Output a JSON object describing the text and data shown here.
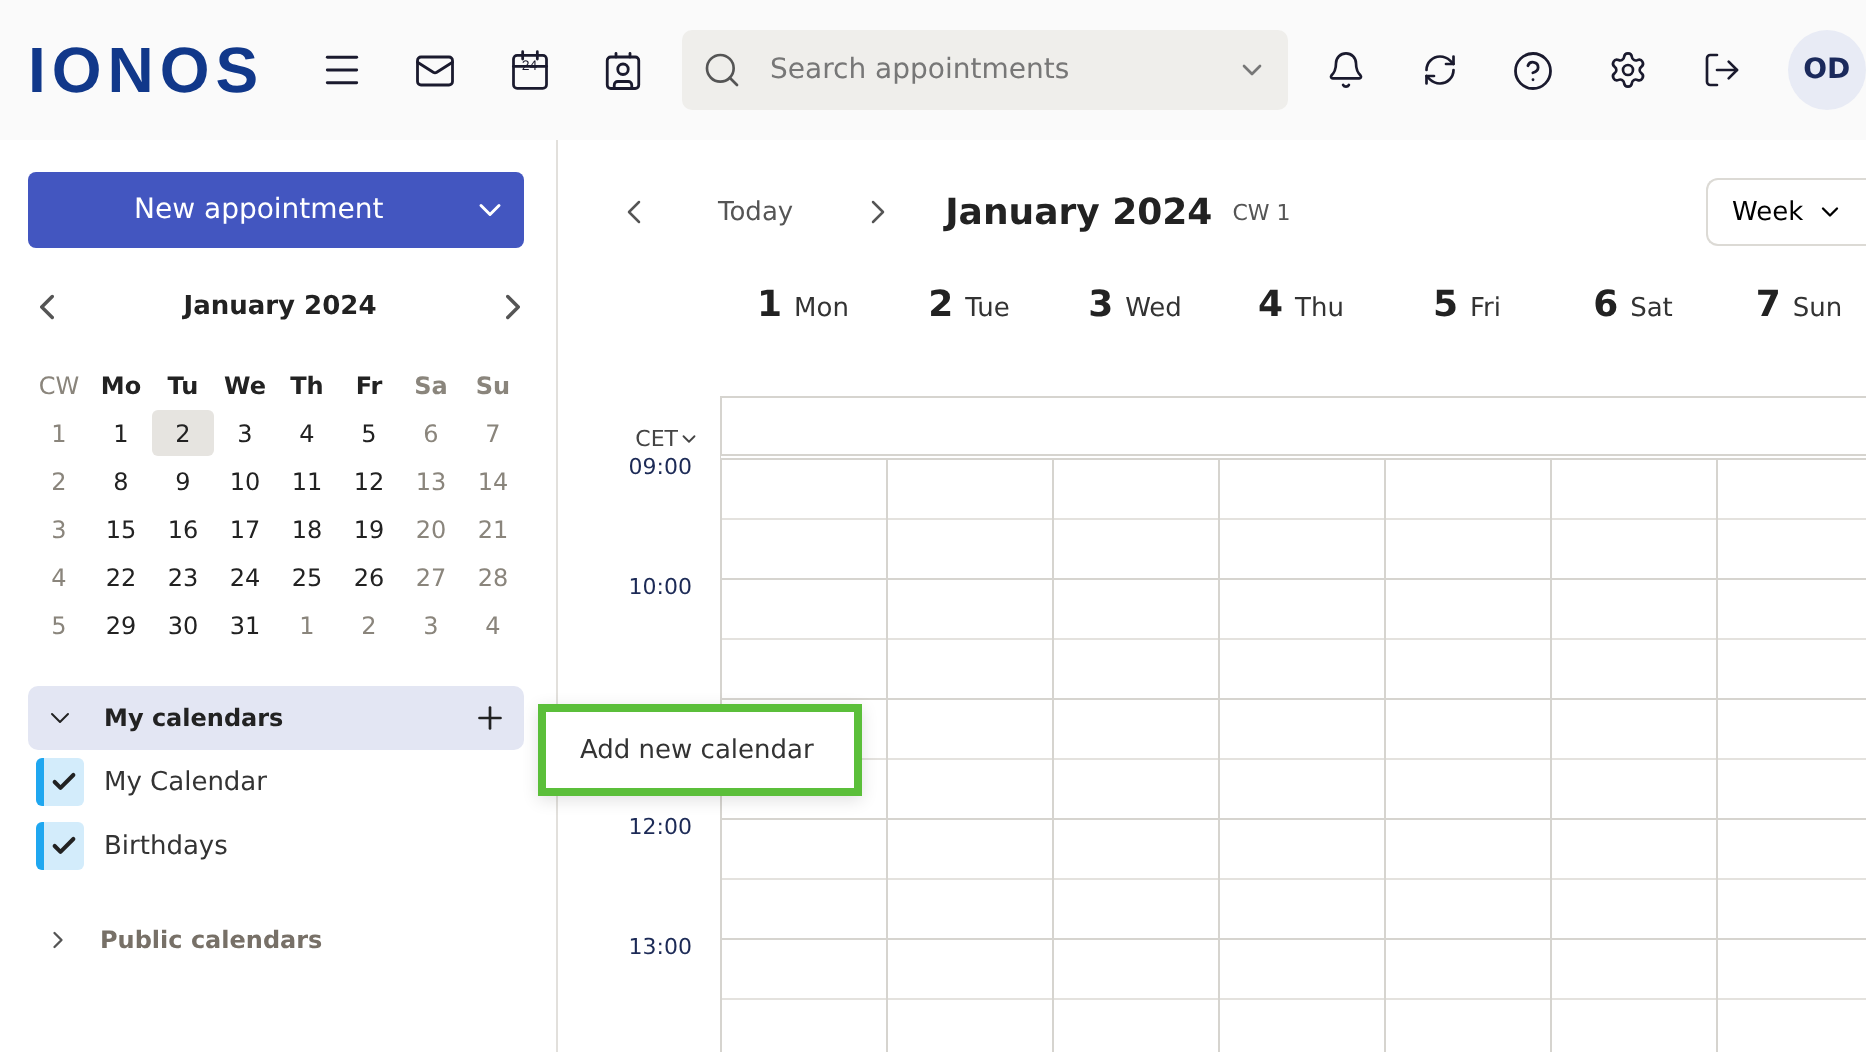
{
  "header": {
    "logo": "IONOS",
    "calendar_icon_day": "24",
    "search_placeholder": "Search appointments",
    "avatar": "OD"
  },
  "sidebar": {
    "new_button": "New appointment",
    "mini_calendar": {
      "title": "January 2024",
      "headers": [
        {
          "label": "CW",
          "muted": true
        },
        {
          "label": "Mo",
          "muted": false
        },
        {
          "label": "Tu",
          "muted": false
        },
        {
          "label": "We",
          "muted": false
        },
        {
          "label": "Th",
          "muted": false
        },
        {
          "label": "Fr",
          "muted": false
        },
        {
          "label": "Sa",
          "muted": true
        },
        {
          "label": "Su",
          "muted": true
        }
      ],
      "weeks": [
        {
          "cw": "1",
          "days": [
            {
              "label": "1",
              "muted": false,
              "selected": false
            },
            {
              "label": "2",
              "muted": false,
              "selected": true
            },
            {
              "label": "3",
              "muted": false,
              "selected": false
            },
            {
              "label": "4",
              "muted": false,
              "selected": false
            },
            {
              "label": "5",
              "muted": false,
              "selected": false
            },
            {
              "label": "6",
              "muted": true,
              "selected": false
            },
            {
              "label": "7",
              "muted": true,
              "selected": false
            }
          ]
        },
        {
          "cw": "2",
          "days": [
            {
              "label": "8",
              "muted": false,
              "selected": false
            },
            {
              "label": "9",
              "muted": false,
              "selected": false
            },
            {
              "label": "10",
              "muted": false,
              "selected": false
            },
            {
              "label": "11",
              "muted": false,
              "selected": false
            },
            {
              "label": "12",
              "muted": false,
              "selected": false
            },
            {
              "label": "13",
              "muted": true,
              "selected": false
            },
            {
              "label": "14",
              "muted": true,
              "selected": false
            }
          ]
        },
        {
          "cw": "3",
          "days": [
            {
              "label": "15",
              "muted": false,
              "selected": false
            },
            {
              "label": "16",
              "muted": false,
              "selected": false
            },
            {
              "label": "17",
              "muted": false,
              "selected": false
            },
            {
              "label": "18",
              "muted": false,
              "selected": false
            },
            {
              "label": "19",
              "muted": false,
              "selected": false
            },
            {
              "label": "20",
              "muted": true,
              "selected": false
            },
            {
              "label": "21",
              "muted": true,
              "selected": false
            }
          ]
        },
        {
          "cw": "4",
          "days": [
            {
              "label": "22",
              "muted": false,
              "selected": false
            },
            {
              "label": "23",
              "muted": false,
              "selected": false
            },
            {
              "label": "24",
              "muted": false,
              "selected": false
            },
            {
              "label": "25",
              "muted": false,
              "selected": false
            },
            {
              "label": "26",
              "muted": false,
              "selected": false
            },
            {
              "label": "27",
              "muted": true,
              "selected": false
            },
            {
              "label": "28",
              "muted": true,
              "selected": false
            }
          ]
        },
        {
          "cw": "5",
          "days": [
            {
              "label": "29",
              "muted": false,
              "selected": false
            },
            {
              "label": "30",
              "muted": false,
              "selected": false
            },
            {
              "label": "31",
              "muted": false,
              "selected": false
            },
            {
              "label": "1",
              "muted": true,
              "selected": false
            },
            {
              "label": "2",
              "muted": true,
              "selected": false
            },
            {
              "label": "3",
              "muted": true,
              "selected": false
            },
            {
              "label": "4",
              "muted": true,
              "selected": false
            }
          ]
        }
      ]
    },
    "my_calendars": {
      "label": "My calendars",
      "expanded": true,
      "items": [
        {
          "label": "My Calendar",
          "checked": true,
          "color": "#1fa7f0"
        },
        {
          "label": "Birthdays",
          "checked": true,
          "color": "#1fa7f0"
        }
      ]
    },
    "public_calendars": {
      "label": "Public calendars",
      "expanded": false
    }
  },
  "popup": {
    "label": "Add new calendar"
  },
  "main": {
    "today": "Today",
    "title": "January 2024",
    "cw": "CW 1",
    "view": "Week",
    "days": [
      {
        "num": "1",
        "name": "Mon"
      },
      {
        "num": "2",
        "name": "Tue"
      },
      {
        "num": "3",
        "name": "Wed"
      },
      {
        "num": "4",
        "name": "Thu"
      },
      {
        "num": "5",
        "name": "Fri"
      },
      {
        "num": "6",
        "name": "Sat"
      },
      {
        "num": "7",
        "name": "Sun"
      }
    ],
    "timezone": "CET",
    "hours": [
      {
        "kind": "labeled",
        "label": "09:00"
      },
      {
        "kind": "labeled",
        "label": "10:00"
      },
      {
        "kind": "covered"
      },
      {
        "kind": "labeled",
        "label": "12:00"
      },
      {
        "kind": "labeled",
        "label": "13:00"
      }
    ]
  }
}
